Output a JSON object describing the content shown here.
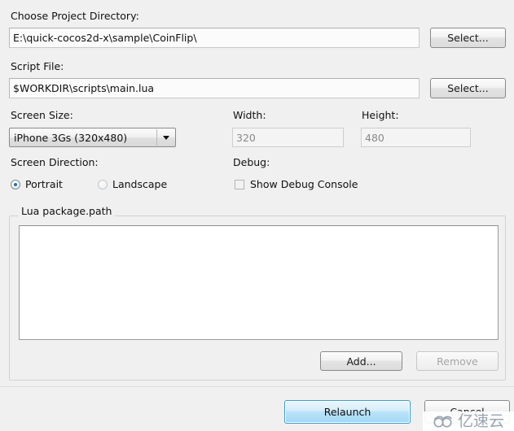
{
  "window": {
    "background_color": "#f0f0f0"
  },
  "project_directory": {
    "label": "Choose Project Directory:",
    "value": "E:\\quick-cocos2d-x\\sample\\CoinFlip\\",
    "select_button": "Select..."
  },
  "script_file": {
    "label": "Script File:",
    "value": "$WORKDIR\\scripts\\main.lua",
    "select_button": "Select..."
  },
  "screen_size": {
    "label": "Screen Size:",
    "selected": "iPhone 3Gs (320x480)",
    "arrow_icon": "chevron-down-icon"
  },
  "width": {
    "label": "Width:",
    "value": "320",
    "enabled": false
  },
  "height": {
    "label": "Height:",
    "value": "480",
    "enabled": false
  },
  "screen_direction": {
    "label": "Screen Direction:",
    "options": [
      {
        "label": "Portrait",
        "checked": true
      },
      {
        "label": "Landscape",
        "checked": false
      }
    ]
  },
  "debug": {
    "label": "Debug:",
    "checkbox_label": "Show Debug Console",
    "checked": false
  },
  "lua_package_path": {
    "title": "Lua package.path",
    "content": "",
    "add_button": "Add...",
    "remove_button": "Remove",
    "remove_enabled": false
  },
  "footer": {
    "relaunch_button": "Relaunch",
    "cancel_button": "Cancel"
  },
  "watermark": {
    "logo_icon": "cloud-logo-icon",
    "text": "亿速云",
    "color": "#9aa4b0"
  }
}
